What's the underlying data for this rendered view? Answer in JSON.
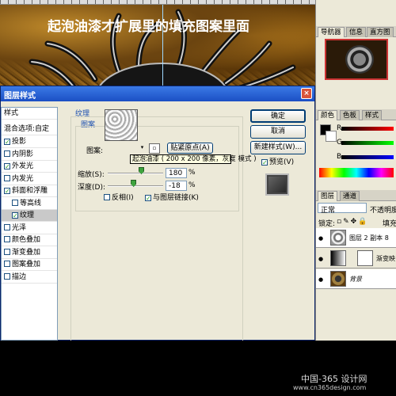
{
  "dialog": {
    "title": "图层样式",
    "close_glyph": "×",
    "styles_header": "样式",
    "blend_options": "混合选项:自定",
    "effects": [
      {
        "label": "投影",
        "checked": true,
        "selected": false,
        "sub": false
      },
      {
        "label": "内阴影",
        "checked": false,
        "selected": false,
        "sub": false
      },
      {
        "label": "外发光",
        "checked": true,
        "selected": false,
        "sub": false
      },
      {
        "label": "内发光",
        "checked": false,
        "selected": false,
        "sub": false
      },
      {
        "label": "斜面和浮雕",
        "checked": true,
        "selected": false,
        "sub": false
      },
      {
        "label": "等高线",
        "checked": false,
        "selected": false,
        "sub": true
      },
      {
        "label": "纹理",
        "checked": true,
        "selected": true,
        "sub": true
      },
      {
        "label": "光泽",
        "checked": false,
        "selected": false,
        "sub": false
      },
      {
        "label": "颜色叠加",
        "checked": false,
        "selected": false,
        "sub": false
      },
      {
        "label": "渐变叠加",
        "checked": false,
        "selected": false,
        "sub": false
      },
      {
        "label": "图案叠加",
        "checked": false,
        "selected": false,
        "sub": false
      },
      {
        "label": "描边",
        "checked": false,
        "selected": false,
        "sub": false
      }
    ],
    "texture": {
      "group_title": "纹理",
      "subgroup_title": "图案",
      "pattern_label": "图案:",
      "snap_button": "贴紧原点(A)",
      "tooltip": "起泡油漆 ( 200 x 200 像素，灰度 模式 )",
      "scale_label": "缩放(S):",
      "scale_value": "180",
      "scale_percent": 0.6,
      "depth_label": "深度(D):",
      "depth_value": "-18",
      "depth_percent": 0.46,
      "percent_unit": "%",
      "invert_label": "反相(I)",
      "invert_checked": false,
      "link_label": "与图层链接(K)",
      "link_checked": true
    },
    "buttons": {
      "ok": "确定",
      "cancel": "取消",
      "new_style": "新建样式(W)...",
      "preview": "预览(V)",
      "preview_checked": true
    }
  },
  "panels": {
    "nav_tabs": [
      "导航器",
      "信息",
      "直方图"
    ],
    "color_tabs": [
      "颜色",
      "色板",
      "样式"
    ],
    "color_labels": [
      "R",
      "G",
      "B"
    ],
    "layers_tabs": [
      "图层",
      "通道"
    ],
    "blend_mode": "正常",
    "opacity_label": "不透明度",
    "lock_label": "锁定:",
    "fill_label": "填充",
    "layers": [
      {
        "name": "图层 2 副本 8"
      },
      {
        "name": "渐变映"
      },
      {
        "name": "背景"
      }
    ]
  },
  "caption": {
    "text": "起泡油漆才扩展里的填充图案里面",
    "watermark": "中国-365 设计网",
    "watermark_url": "www.cn365design.com"
  }
}
